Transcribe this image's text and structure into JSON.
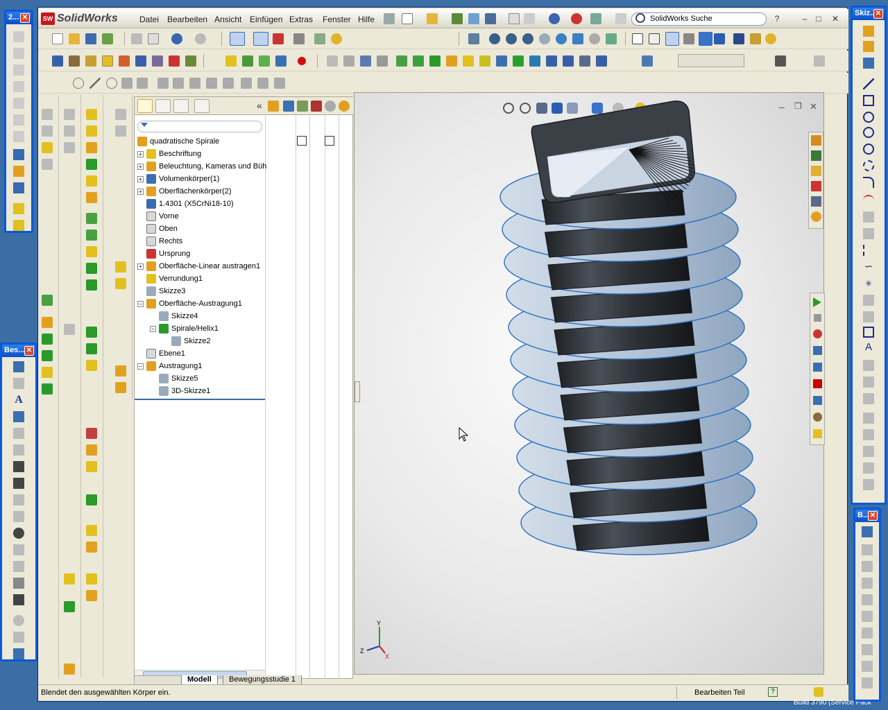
{
  "app": {
    "name": "SolidWorks"
  },
  "menu": [
    "Datei",
    "Bearbeiten",
    "Ansicht",
    "Einfügen",
    "Extras",
    "Fenster",
    "Hilfe"
  ],
  "search": {
    "value": "SolidWorks Suche"
  },
  "feature_tree": {
    "root": "quadratische Spirale",
    "items": [
      {
        "label": "Beschriftung",
        "level": 0,
        "expand": "+",
        "icon": "annotation-icon"
      },
      {
        "label": "Beleuchtung, Kameras und Büh",
        "level": 0,
        "expand": "+",
        "icon": "lights-icon"
      },
      {
        "label": "Volumenkörper(1)",
        "level": 0,
        "expand": "+",
        "icon": "solid-bodies-icon"
      },
      {
        "label": "Oberflächenkörper(2)",
        "level": 0,
        "expand": "+",
        "icon": "surface-bodies-icon"
      },
      {
        "label": "1.4301 (X5CrNi18-10)",
        "level": 0,
        "expand": "",
        "icon": "material-icon"
      },
      {
        "label": "Vorne",
        "level": 0,
        "expand": "",
        "icon": "plane-icon"
      },
      {
        "label": "Oben",
        "level": 0,
        "expand": "",
        "icon": "plane-icon"
      },
      {
        "label": "Rechts",
        "level": 0,
        "expand": "",
        "icon": "plane-icon"
      },
      {
        "label": "Ursprung",
        "level": 0,
        "expand": "",
        "icon": "origin-icon"
      },
      {
        "label": "Oberfläche-Linear austragen1",
        "level": 0,
        "expand": "+",
        "icon": "surface-extrude-icon"
      },
      {
        "label": "Verrundung1",
        "level": 0,
        "expand": "",
        "icon": "fillet-icon"
      },
      {
        "label": "Skizze3",
        "level": 0,
        "expand": "",
        "icon": "sketch-icon"
      },
      {
        "label": "Oberfläche-Austragung1",
        "level": 0,
        "expand": "-",
        "icon": "surface-sweep-icon"
      },
      {
        "label": "Skizze4",
        "level": 1,
        "expand": "",
        "icon": "sketch-icon"
      },
      {
        "label": "Spirale/Helix1",
        "level": 1,
        "expand": "-",
        "icon": "helix-icon"
      },
      {
        "label": "Skizze2",
        "level": 2,
        "expand": "",
        "icon": "sketch-icon"
      },
      {
        "label": "Ebene1",
        "level": 0,
        "expand": "",
        "icon": "plane-icon"
      },
      {
        "label": "Austragung1",
        "level": 0,
        "expand": "-",
        "icon": "sweep-icon"
      },
      {
        "label": "Skizze5",
        "level": 1,
        "expand": "",
        "icon": "sketch-icon"
      },
      {
        "label": "3D-Skizze1",
        "level": 1,
        "expand": "",
        "icon": "3d-sketch-icon"
      }
    ]
  },
  "bottom_tabs": [
    "Modell",
    "Bewegungsstudie 1"
  ],
  "status": {
    "message": "Blendet den ausgewählten Körper ein.",
    "mode": "Bearbeiten Teil",
    "build": "Build 3790 (Service Pack"
  },
  "floating_toolbars": {
    "left_top": "2...",
    "left_bottom": "Bes...",
    "right_top": "Skiz...",
    "right_bottom": "B..."
  },
  "colors": {
    "titlebar": "#0a58d8",
    "toolbar_bg": "#ece9d8",
    "model_blue": "#b7c8dc",
    "model_edge": "#2a6fc0",
    "model_dark": "#2f3338"
  }
}
